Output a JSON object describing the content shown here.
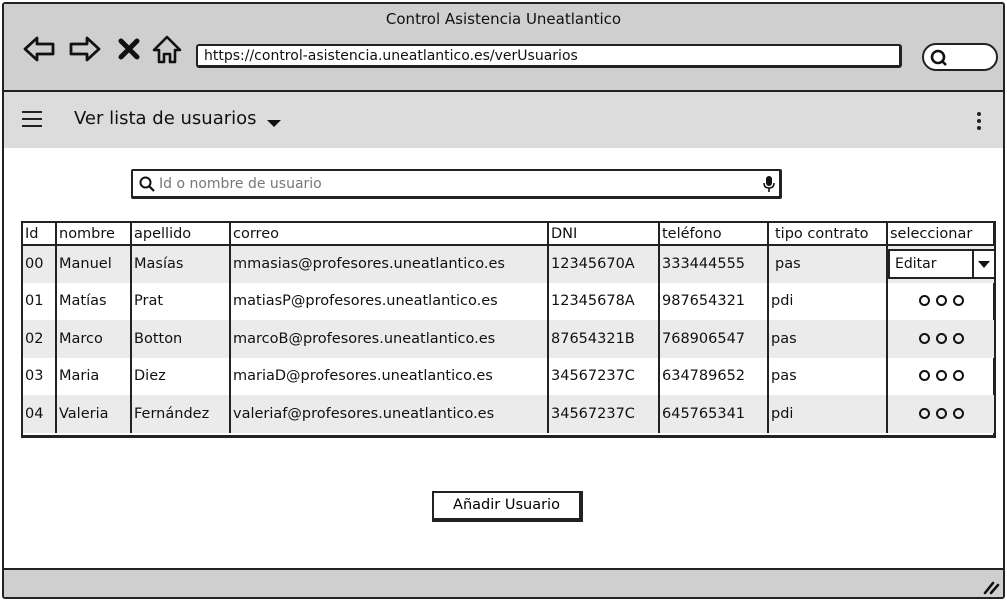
{
  "window": {
    "title": "Control Asistencia Uneatlantico"
  },
  "browser": {
    "url": "https://control-asistencia.uneatlantico.es/verUsuarios",
    "icons": [
      "back-arrow-icon",
      "forward-arrow-icon",
      "close-icon",
      "home-icon",
      "search-icon"
    ]
  },
  "appbar": {
    "title": "Ver lista de usuarios"
  },
  "search": {
    "placeholder": "Id o nombre de usuario",
    "value": ""
  },
  "table": {
    "headers": [
      "Id",
      "nombre",
      "apellido",
      "correo",
      "DNI",
      "teléfono",
      "tipo contrato",
      "seleccionar"
    ],
    "rows": [
      {
        "id": "00",
        "nombre": "Manuel",
        "apellido": "Masías",
        "correo": "mmasias@profesores.uneatlantico.es",
        "dni": "12345670A",
        "telefono": "333444555",
        "tipo": "pas",
        "seleccionar": "Editar"
      },
      {
        "id": "01",
        "nombre": "Matías",
        "apellido": "Prat",
        "correo": "matiasP@profesores.uneatlantico.es",
        "dni": "12345678A",
        "telefono": "987654321",
        "tipo": "pdi",
        "seleccionar": ""
      },
      {
        "id": "02",
        "nombre": "Marco",
        "apellido": "Botton",
        "correo": "marcoB@profesores.uneatlantico.es",
        "dni": "87654321B",
        "telefono": "768906547",
        "tipo": "pas",
        "seleccionar": ""
      },
      {
        "id": "03",
        "nombre": "Maria",
        "apellido": "Diez",
        "correo": "mariaD@profesores.uneatlantico.es",
        "dni": "34567237C",
        "telefono": "634789652",
        "tipo": "pas",
        "seleccionar": ""
      },
      {
        "id": "04",
        "nombre": "Valeria",
        "apellido": "Fernández",
        "correo": "valeriaf@profesores.uneatlantico.es",
        "dni": "34567237C",
        "telefono": "645765341",
        "tipo": "pdi",
        "seleccionar": ""
      }
    ]
  },
  "actions": {
    "add_user": "Añadir Usuario"
  },
  "colors": {
    "chrome": "#cfcfcf",
    "appbar": "#dcdcdc",
    "row_shade": "#ebebeb",
    "border": "#222222"
  }
}
